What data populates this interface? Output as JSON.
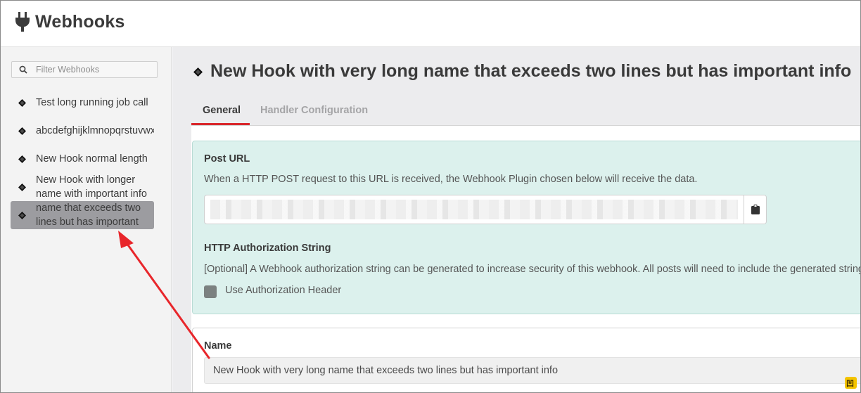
{
  "header": {
    "title": "Webhooks",
    "icon": "plug-icon"
  },
  "sidebar": {
    "filter": {
      "placeholder": "Filter Webhooks",
      "value": ""
    },
    "items": [
      {
        "label": "Test long running job call",
        "icon": "diamond-icon"
      },
      {
        "label": "abcdefghijklmnopqrstuvwxyz",
        "icon": "diamond-icon"
      },
      {
        "label": "New Hook normal length",
        "icon": "diamond-icon"
      },
      {
        "label": "New Hook with longer name with important info",
        "icon": "diamond-icon"
      },
      {
        "label": "name that exceeds two lines but has important",
        "icon": "diamond-icon",
        "selected": true
      }
    ]
  },
  "main": {
    "title": "New Hook with very long name that exceeds two lines but has important info",
    "tabs": [
      {
        "label": "General",
        "active": true
      },
      {
        "label": "Handler Configuration",
        "active": false
      }
    ],
    "post_url": {
      "label": "Post URL",
      "description": "When a HTTP POST request to this URL is received, the Webhook Plugin chosen below will receive the data.",
      "copy_icon": "clipboard-icon"
    },
    "auth": {
      "label": "HTTP Authorization String",
      "description": "[Optional] A Webhook authorization string can be generated to increase security of this webhook. All posts will need to include the generated string",
      "checkbox_label": "Use Authorization Header",
      "checked": false
    },
    "name": {
      "label": "Name",
      "value": "New Hook with very long name that exceeds two lines but has important info"
    }
  },
  "colors": {
    "accent": "#d9262b",
    "teal_card": "#dcf1ed",
    "selected_item": "#9c9ca0",
    "annotation_arrow": "#e8262b"
  }
}
